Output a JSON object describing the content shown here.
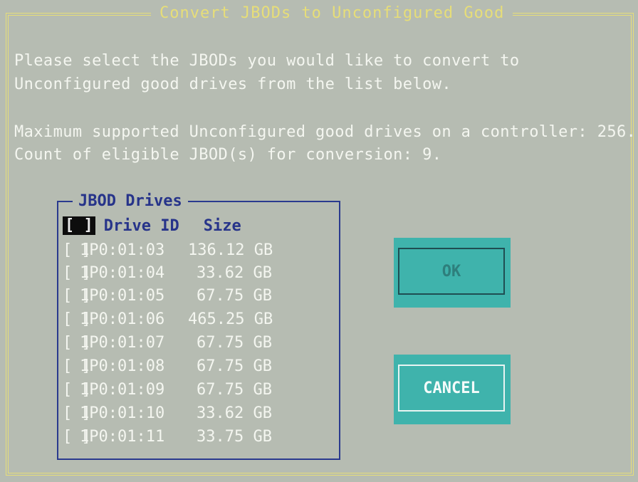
{
  "dialog": {
    "title": "Convert JBODs to Unconfigured Good",
    "instructions_line1": "Please select the JBODs you would like to convert to",
    "instructions_line2": "Unconfigured good drives from the list below.",
    "max_supported": "Maximum supported Unconfigured good drives on a controller: 256.",
    "eligible_count": "Count of eligible JBOD(s) for conversion: 9."
  },
  "jbod_list": {
    "group_title": "JBOD Drives",
    "select_all_checkbox": "[ ]",
    "header_drive_id": "Drive ID",
    "header_size": "Size",
    "drives": [
      {
        "checkbox": "[ ]",
        "id": "1P0:01:03",
        "size": "136.12 GB"
      },
      {
        "checkbox": "[ ]",
        "id": "1P0:01:04",
        "size": "33.62 GB"
      },
      {
        "checkbox": "[ ]",
        "id": "1P0:01:05",
        "size": "67.75 GB"
      },
      {
        "checkbox": "[ ]",
        "id": "1P0:01:06",
        "size": "465.25 GB"
      },
      {
        "checkbox": "[ ]",
        "id": "1P0:01:07",
        "size": "67.75 GB"
      },
      {
        "checkbox": "[ ]",
        "id": "1P0:01:08",
        "size": "67.75 GB"
      },
      {
        "checkbox": "[ ]",
        "id": "1P0:01:09",
        "size": "67.75 GB"
      },
      {
        "checkbox": "[ ]",
        "id": "1P0:01:10",
        "size": "33.62 GB"
      },
      {
        "checkbox": "[ ]",
        "id": "1P0:01:11",
        "size": "33.75 GB"
      }
    ]
  },
  "buttons": {
    "ok_label": "OK",
    "cancel_label": "CANCEL"
  },
  "colors": {
    "background": "#b6bcb2",
    "frame_yellow": "#e7de78",
    "list_blue": "#27348a",
    "button_teal": "#3fb3ac"
  }
}
